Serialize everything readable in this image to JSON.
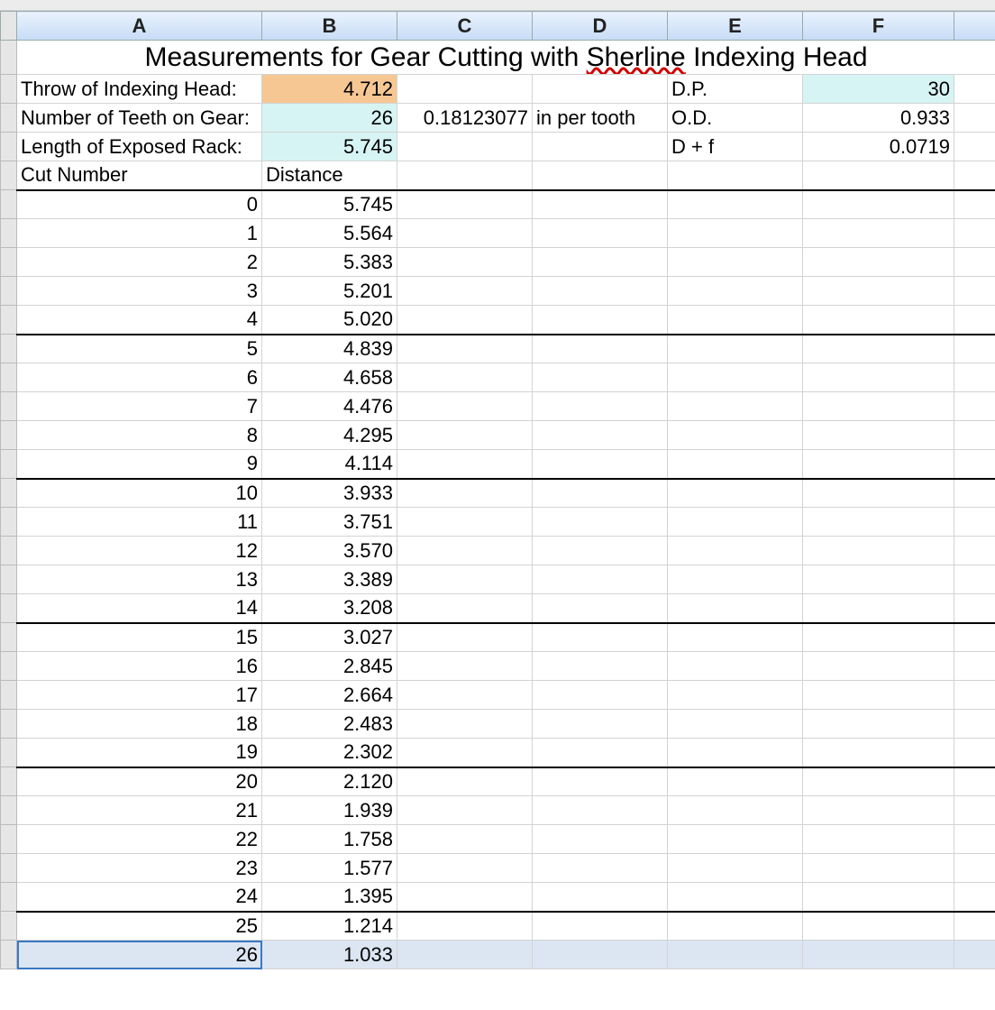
{
  "columns": [
    "A",
    "B",
    "C",
    "D",
    "E",
    "F"
  ],
  "title_parts": {
    "pre": "Measurements for Gear Cutting with ",
    "word": "Sherline",
    "post": " Indexing Head"
  },
  "params": {
    "throw_label": "Throw of Indexing Head:",
    "throw_val": "4.712",
    "teeth_label": "Number of Teeth on Gear:",
    "teeth_val": "26",
    "per_tooth": "0.18123077",
    "per_tooth_unit": "in per tooth",
    "rack_label": "Length of Exposed Rack:",
    "rack_val": "5.745",
    "dp_label": "D.P.",
    "dp_val": "30",
    "od_label": "O.D.",
    "od_val": "0.933",
    "df_label": "D + f",
    "df_val": "0.0719"
  },
  "table_header": {
    "a": "Cut Number",
    "b": "Distance"
  },
  "rows": [
    {
      "cut": "0",
      "dist": "5.745"
    },
    {
      "cut": "1",
      "dist": "5.564"
    },
    {
      "cut": "2",
      "dist": "5.383"
    },
    {
      "cut": "3",
      "dist": "5.201"
    },
    {
      "cut": "4",
      "dist": "5.020"
    },
    {
      "cut": "5",
      "dist": "4.839"
    },
    {
      "cut": "6",
      "dist": "4.658"
    },
    {
      "cut": "7",
      "dist": "4.476"
    },
    {
      "cut": "8",
      "dist": "4.295"
    },
    {
      "cut": "9",
      "dist": "4.114"
    },
    {
      "cut": "10",
      "dist": "3.933"
    },
    {
      "cut": "11",
      "dist": "3.751"
    },
    {
      "cut": "12",
      "dist": "3.570"
    },
    {
      "cut": "13",
      "dist": "3.389"
    },
    {
      "cut": "14",
      "dist": "3.208"
    },
    {
      "cut": "15",
      "dist": "3.027"
    },
    {
      "cut": "16",
      "dist": "2.845"
    },
    {
      "cut": "17",
      "dist": "2.664"
    },
    {
      "cut": "18",
      "dist": "2.483"
    },
    {
      "cut": "19",
      "dist": "2.302"
    },
    {
      "cut": "20",
      "dist": "2.120"
    },
    {
      "cut": "21",
      "dist": "1.939"
    },
    {
      "cut": "22",
      "dist": "1.758"
    },
    {
      "cut": "23",
      "dist": "1.577"
    },
    {
      "cut": "24",
      "dist": "1.395"
    },
    {
      "cut": "25",
      "dist": "1.214"
    },
    {
      "cut": "26",
      "dist": "1.033"
    }
  ]
}
